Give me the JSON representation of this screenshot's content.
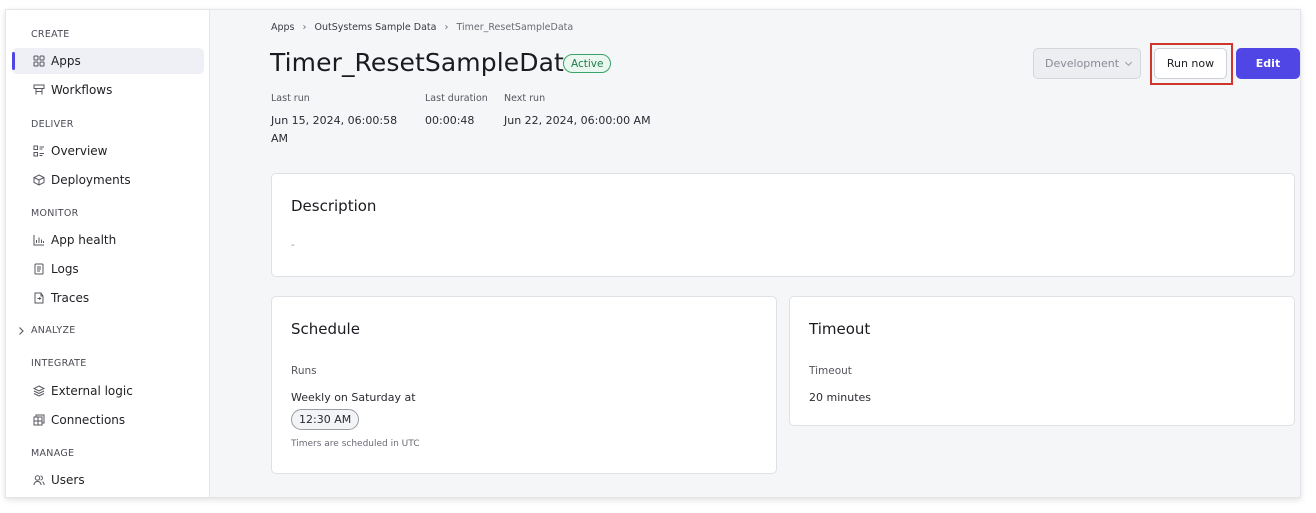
{
  "sidebar": {
    "sections": {
      "create": "CREATE",
      "deliver": "DELIVER",
      "monitor": "MONITOR",
      "analyze": "ANALYZE",
      "integrate": "INTEGRATE",
      "manage": "MANAGE"
    },
    "items": {
      "apps": {
        "label": "Apps",
        "icon": "grid-icon",
        "active": true
      },
      "workflows": {
        "label": "Workflows",
        "icon": "workflow-icon"
      },
      "overview": {
        "label": "Overview",
        "icon": "overview-icon"
      },
      "deployments": {
        "label": "Deployments",
        "icon": "cube-icon"
      },
      "app_health": {
        "label": "App health",
        "icon": "bar-chart-icon"
      },
      "logs": {
        "label": "Logs",
        "icon": "document-icon"
      },
      "traces": {
        "label": "Traces",
        "icon": "trace-icon"
      },
      "external_logic": {
        "label": "External logic",
        "icon": "layers-icon"
      },
      "connections": {
        "label": "Connections",
        "icon": "connections-icon"
      },
      "users": {
        "label": "Users",
        "icon": "users-icon"
      }
    }
  },
  "breadcrumb": {
    "items": [
      "Apps",
      "OutSystems Sample Data",
      "Timer_ResetSampleData"
    ]
  },
  "header": {
    "title": "Timer_ResetSampleData",
    "status": "Active",
    "environment": "Development",
    "run_now_label": "Run now",
    "edit_label": "Edit"
  },
  "meta": {
    "last_run_label": "Last run",
    "last_run_line1": "Jun 15, 2024, 06:00:58",
    "last_run_line2": "AM",
    "last_duration_label": "Last duration",
    "last_duration_value": "00:00:48",
    "next_run_label": "Next run",
    "next_run_value": "Jun 22, 2024, 06:00:00 AM"
  },
  "description": {
    "title": "Description",
    "value": "-"
  },
  "schedule": {
    "title": "Schedule",
    "runs_label": "Runs",
    "runs_value": "Weekly on Saturday at",
    "time": "12:30 AM",
    "note": "Timers are scheduled in UTC"
  },
  "timeout": {
    "title": "Timeout",
    "label": "Timeout",
    "value": "20 minutes"
  },
  "colors": {
    "accent": "#4f46e5",
    "highlight": "#d0352b",
    "status_green": "#3aa36a"
  }
}
